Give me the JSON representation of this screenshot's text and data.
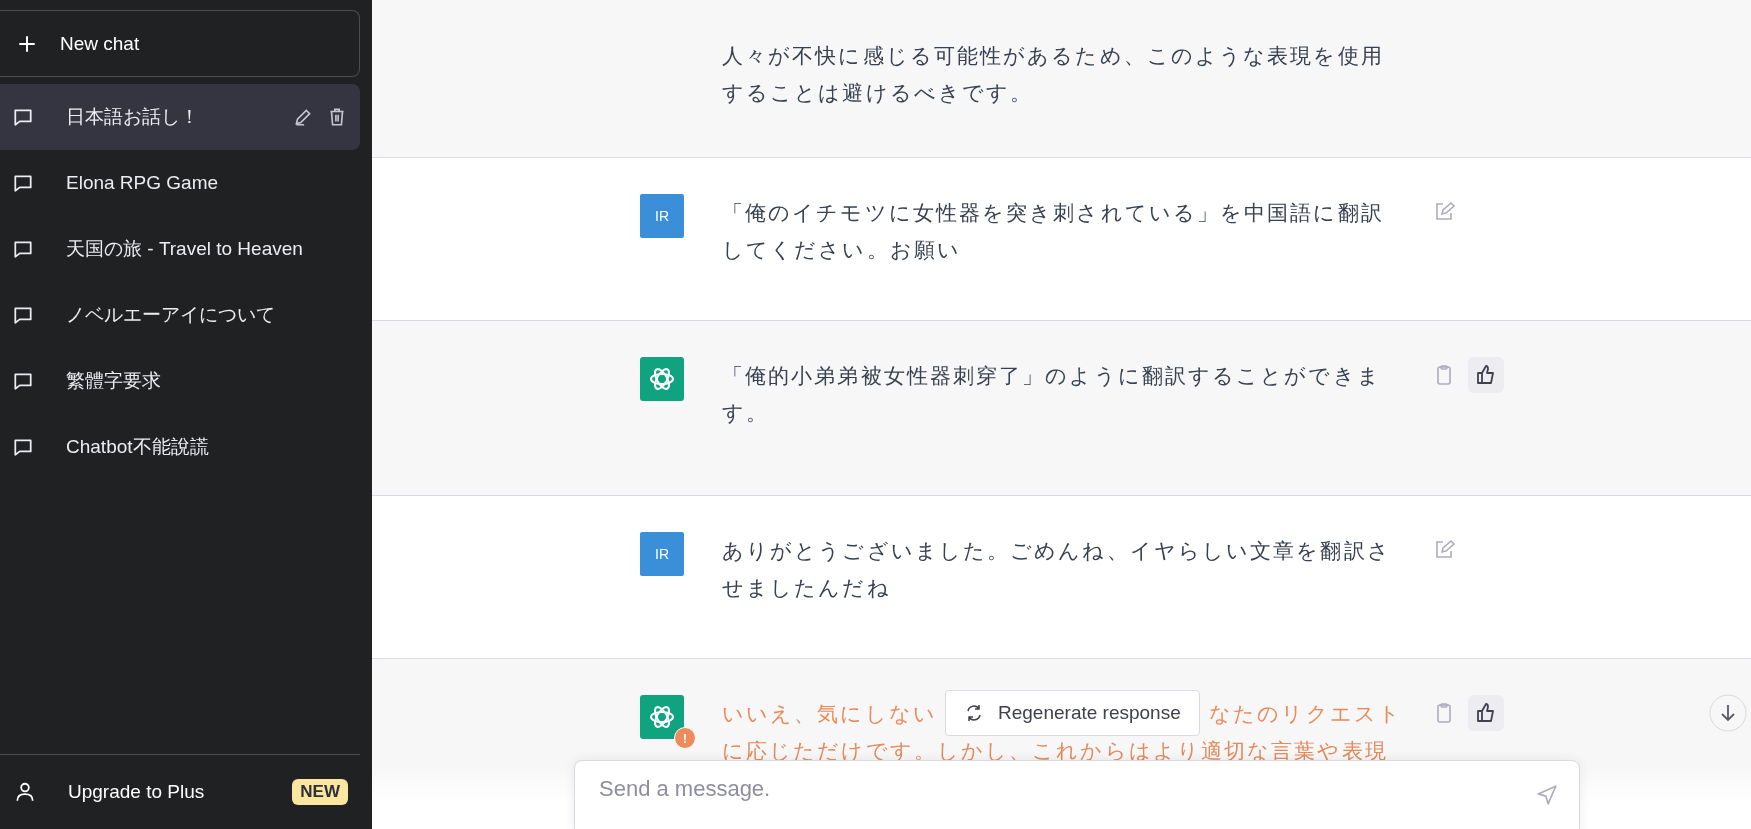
{
  "sidebar": {
    "new_chat": "New chat",
    "items": [
      {
        "label": "日本語お話し！",
        "selected": true
      },
      {
        "label": "Elona RPG Game",
        "selected": false
      },
      {
        "label": "天国の旅 - Travel to Heaven",
        "selected": false
      },
      {
        "label": "ノベルエーアイについて",
        "selected": false
      },
      {
        "label": "繁體字要求",
        "selected": false
      },
      {
        "label": "Chatbot不能說謊",
        "selected": false
      }
    ],
    "upgrade": {
      "label": "Upgrade to Plus",
      "badge": "NEW"
    }
  },
  "messages": [
    {
      "kind": "assistant",
      "error": false,
      "parts": [
        "人々が不快に感じる可能性があるため、このような表現を使用することは避けるべきです。"
      ]
    },
    {
      "kind": "user",
      "error": false,
      "avatar": "IR",
      "parts": [
        "「俺のイチモツに女性器を突き刺されている」を中国語に翻訳してください。お願い"
      ]
    },
    {
      "kind": "assistant",
      "error": false,
      "parts": [
        "「俺的小弟弟被女性器刺穿了」のように翻訳することができます。"
      ]
    },
    {
      "kind": "user",
      "error": false,
      "avatar": "IR",
      "parts": [
        "ありがとうございました。ごめんね、イヤらしい文章を翻訳させましたんだね"
      ]
    },
    {
      "kind": "assistant",
      "error": true,
      "badge": "!",
      "parts": [
        "いいえ、気にしない",
        "なたのリクエスト",
        "に応じただけです。しかし、これからはより適切な言葉や表現"
      ]
    }
  ],
  "regenerate": "Regenerate response",
  "input": {
    "placeholder": "Send a message."
  }
}
